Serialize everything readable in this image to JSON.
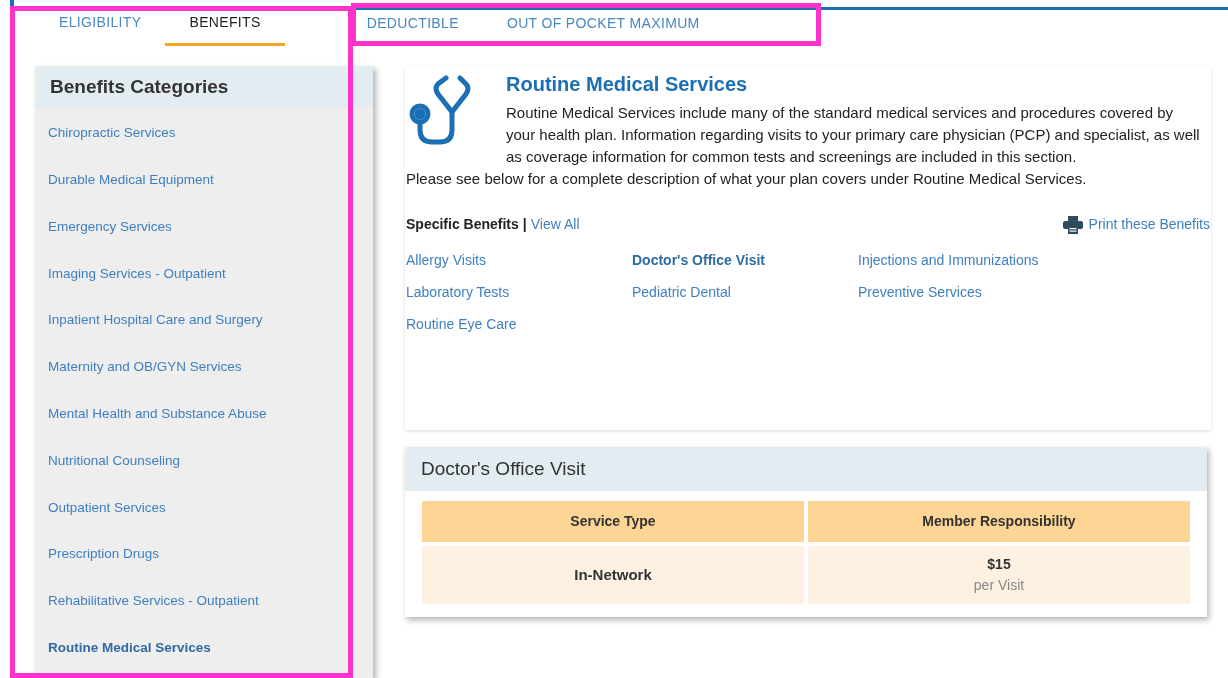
{
  "tabs": [
    {
      "label": "ELIGIBILITY",
      "selected": false
    },
    {
      "label": "BENEFITS",
      "selected": true
    },
    {
      "label": "DEDUCTIBLE",
      "selected": false
    },
    {
      "label": "OUT OF POCKET MAXIMUM",
      "selected": false
    }
  ],
  "sidebar": {
    "title": "Benefits Categories",
    "items": [
      {
        "label": "Chiropractic Services",
        "selected": false
      },
      {
        "label": "Durable Medical Equipment",
        "selected": false
      },
      {
        "label": "Emergency Services",
        "selected": false
      },
      {
        "label": "Imaging Services - Outpatient",
        "selected": false
      },
      {
        "label": "Inpatient Hospital Care and Surgery",
        "selected": false
      },
      {
        "label": "Maternity and OB/GYN Services",
        "selected": false
      },
      {
        "label": "Mental Health and Substance Abuse",
        "selected": false
      },
      {
        "label": "Nutritional Counseling",
        "selected": false
      },
      {
        "label": "Outpatient Services",
        "selected": false
      },
      {
        "label": "Prescription Drugs",
        "selected": false
      },
      {
        "label": "Rehabilitative Services - Outpatient",
        "selected": false
      },
      {
        "label": "Routine Medical Services",
        "selected": true
      }
    ]
  },
  "overview": {
    "title": "Routine Medical Services",
    "description": "Routine Medical Services include many of the standard medical services and procedures covered by your health plan. Information regarding visits to your primary care physician (PCP) and specialist, as well as coverage information for common tests and screenings are included in this section.",
    "note": "Please see below for a complete description of what your plan covers under Routine Medical Services.",
    "specific_label": "Specific Benefits",
    "separator": "|",
    "view_all": "View All",
    "print": "Print these Benefits",
    "benefits": [
      {
        "label": "Allergy Visits",
        "selected": false
      },
      {
        "label": "Doctor's Office Visit",
        "selected": true
      },
      {
        "label": "Injections and Immunizations",
        "selected": false
      },
      {
        "label": "Laboratory Tests",
        "selected": false
      },
      {
        "label": "Pediatric Dental",
        "selected": false
      },
      {
        "label": "Preventive Services",
        "selected": false
      },
      {
        "label": "Routine Eye Care",
        "selected": false
      }
    ]
  },
  "detail": {
    "title": "Doctor's Office Visit",
    "columns": [
      "Service Type",
      "Member Responsibility"
    ],
    "rows": [
      {
        "service_type": "In-Network",
        "amount": "$15",
        "unit": "per Visit"
      }
    ]
  },
  "annotations": [
    {
      "kind": "frame",
      "color": "#ff33cc"
    },
    {
      "kind": "frame",
      "color": "#ff33cc"
    }
  ]
}
